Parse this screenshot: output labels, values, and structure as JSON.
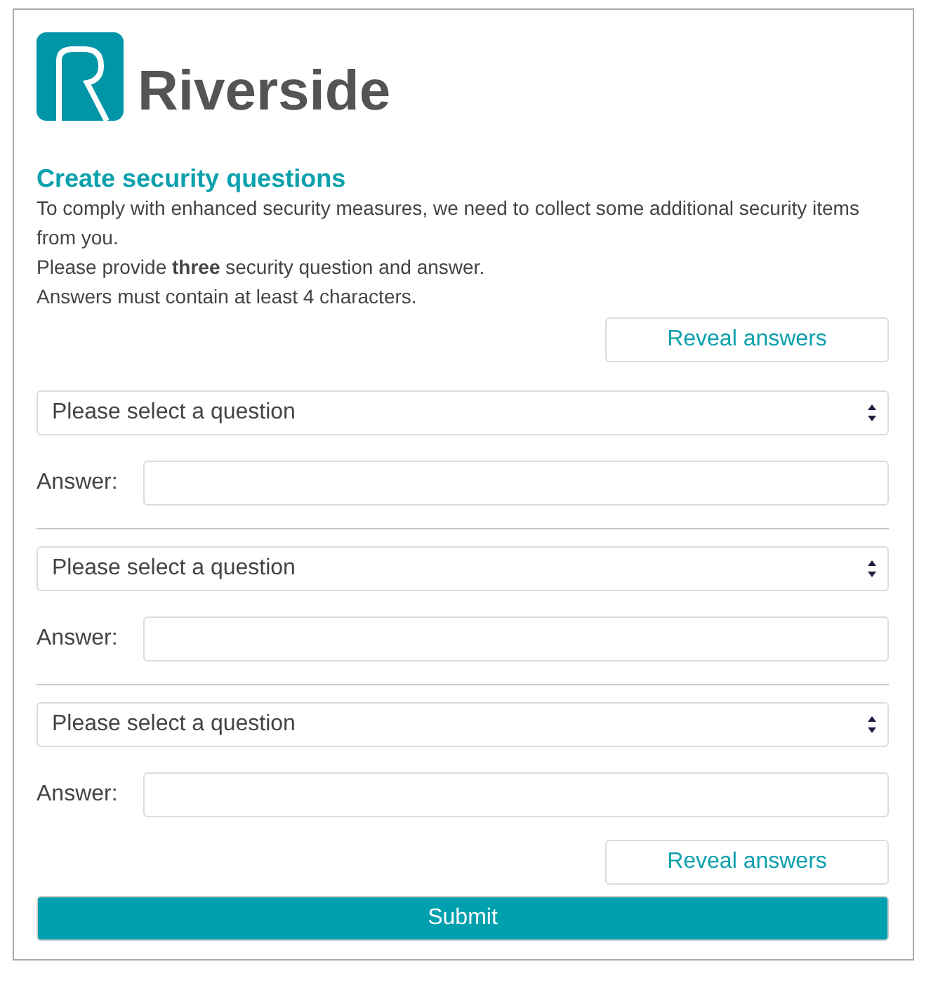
{
  "logo": {
    "text": "Riverside"
  },
  "heading": "Create security questions",
  "intro": [
    "To comply with enhanced security measures, we need to collect some additional security items from you.",
    "Please provide **three** security question and answer.",
    "Answers must contain at least 4 characters."
  ],
  "reveal_button_top": "Reveal answers",
  "questions": [
    {
      "select": "Please select a question",
      "answer_label": "Answer:"
    },
    {
      "select": "Please select a question",
      "answer_label": "Answer:"
    },
    {
      "select": "Please select a question",
      "answer_label": "Answer:"
    }
  ],
  "reveal_button_bottom": "Reveal answers",
  "submit_button": "Submit"
}
